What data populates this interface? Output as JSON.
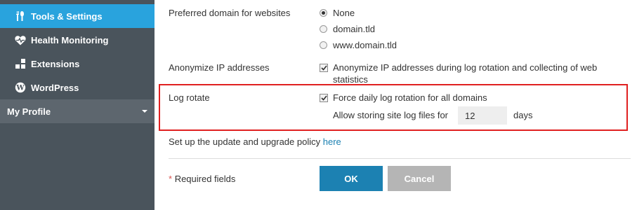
{
  "sidebar": {
    "items": [
      {
        "label": "Tools & Settings",
        "icon": "tools-icon",
        "active": true
      },
      {
        "label": "Health Monitoring",
        "icon": "heart-pulse-icon"
      },
      {
        "label": "Extensions",
        "icon": "extensions-icon"
      },
      {
        "label": "WordPress",
        "icon": "wordpress-icon"
      }
    ],
    "profile_label": "My Profile"
  },
  "form": {
    "preferred_domain": {
      "label": "Preferred domain for websites",
      "options": [
        "None",
        "domain.tld",
        "www.domain.tld"
      ],
      "selected": "None"
    },
    "anonymize": {
      "label": "Anonymize IP addresses",
      "checkbox_label": "Anonymize IP addresses during log rotation and collecting of web statistics",
      "checked": true
    },
    "log_rotate": {
      "label": "Log rotate",
      "checkbox_label": "Force daily log rotation for all domains",
      "checked": true,
      "storing_prefix": "Allow storing site log files for",
      "storing_value": "12",
      "storing_suffix": "days"
    },
    "update_policy": {
      "text": "Set up the update and upgrade policy",
      "link": "here"
    },
    "required_mark": "*",
    "required_text": "Required fields",
    "ok_label": "OK",
    "cancel_label": "Cancel"
  },
  "colors": {
    "sidebar_bg": "#4a545c",
    "active_item": "#29a3dd",
    "profile_bg": "#5d666e",
    "primary_button": "#1c81b2",
    "cancel_button": "#b5b5b5",
    "highlight_border": "#e02020",
    "required_asterisk": "#d9534f"
  }
}
